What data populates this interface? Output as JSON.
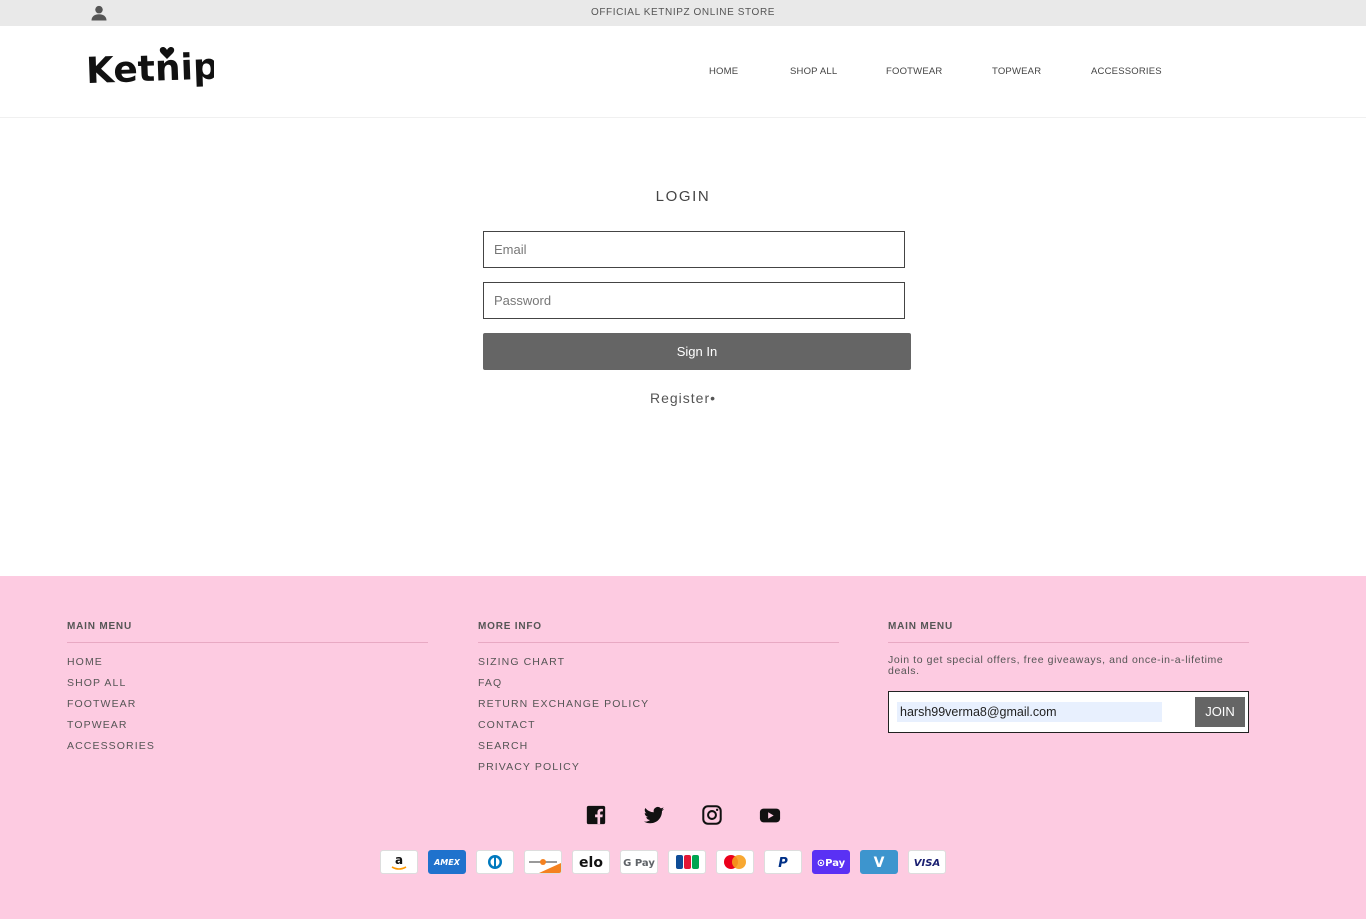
{
  "announcement": "OFFICIAL KETNIPZ ONLINE STORE",
  "brand": {
    "name": "Ketnipz"
  },
  "nav": [
    "HOME",
    "SHOP ALL",
    "FOOTWEAR",
    "TOPWEAR",
    "ACCESSORIES"
  ],
  "login": {
    "title": "LOGIN",
    "email_placeholder": "Email",
    "password_placeholder": "Password",
    "signin_label": "Sign In",
    "register_label": "Register•"
  },
  "footer": {
    "col1": {
      "title": "MAIN MENU",
      "items": [
        "HOME",
        "SHOP ALL",
        "FOOTWEAR",
        "TOPWEAR",
        "ACCESSORIES"
      ]
    },
    "col2": {
      "title": "MORE INFO",
      "items": [
        "SIZING CHART",
        "FAQ",
        "RETURN EXCHANGE POLICY",
        "CONTACT",
        "SEARCH",
        "PRIVACY POLICY"
      ]
    },
    "col3": {
      "title": "MAIN MENU",
      "text": "Join to get special offers, free giveaways, and once-in-a-lifetime deals.",
      "email_value": "harsh99verma8@gmail.com",
      "join_label": "JOIN"
    },
    "social": [
      "facebook-icon",
      "twitter-icon",
      "instagram-icon",
      "youtube-icon"
    ],
    "payments": [
      "amazon",
      "amex",
      "diners",
      "discover",
      "elo",
      "gpay",
      "jcb",
      "mastercard",
      "paypal",
      "shoppay",
      "venmo",
      "visa"
    ]
  },
  "colors": {
    "footer_bg": "#fdcbe1",
    "button": "#656565"
  }
}
